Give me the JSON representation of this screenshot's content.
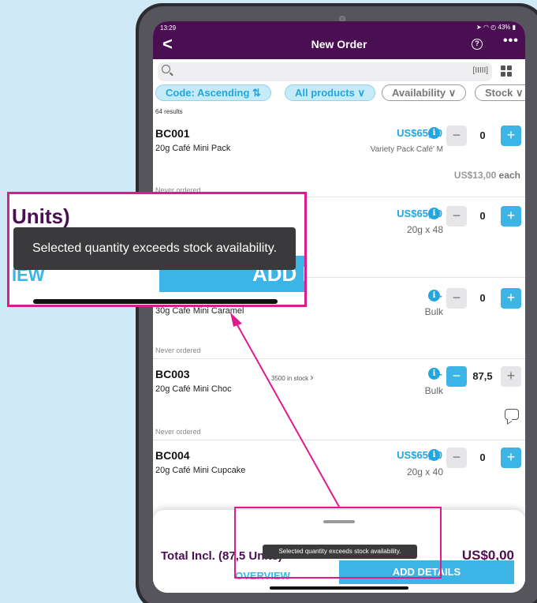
{
  "status_bar": {
    "time": "13:29",
    "indicators": "➤ ◠ ◴ 43% ▮"
  },
  "header": {
    "title": "New Order",
    "back_glyph": "<",
    "help_glyph": "?",
    "more_glyph": "•••"
  },
  "search": {
    "placeholder": "",
    "barcode_glyph": "[IIIII]"
  },
  "filters": [
    {
      "label": "Code: Ascending ⇅"
    },
    {
      "label": "All products ∨"
    },
    {
      "label": "Availability ∨"
    },
    {
      "label": "Stock ∨"
    }
  ],
  "results_count": "64 results",
  "products": [
    {
      "code": "BC001",
      "name": "20g Café Mini Pack",
      "price": "US$65,00",
      "subtitle": "Variety Pack Café' M",
      "each": "US$13,00",
      "each_suffix": "each",
      "qty": "0",
      "history": "Never ordered"
    },
    {
      "code": "",
      "name": "",
      "price": "US$65,00",
      "subtitle": "20g x 48",
      "qty": "0",
      "history": ""
    },
    {
      "code": "",
      "name": "30g Cafe Mini Caramel",
      "price": "$ -",
      "subtitle": "Bulk",
      "qty": "0",
      "history": "Never ordered"
    },
    {
      "code": "BC003",
      "name": "20g Café Mini Choc",
      "stock": "3500 in stock",
      "price": "$ -",
      "subtitle": "Bulk",
      "qty": "87,5",
      "history": "Never ordered"
    },
    {
      "code": "BC004",
      "name": "20g Café Mini Cupcake",
      "price": "US$65,00",
      "subtitle": "20g x 40",
      "qty": "0",
      "history": ""
    }
  ],
  "footer": {
    "total_label": "Total Incl. (87,5 Units)",
    "total_amount": "US$0,00",
    "overview_label": "OVERVIEW",
    "add_details_label": "ADD DETAILS",
    "toast": "Selected quantity exceeds stock availability."
  },
  "zoom": {
    "total_fragment": "Units)",
    "toast": "Selected quantity exceeds stock availability.",
    "overview_fragment": "IEW",
    "add_fragment": "ADD D"
  },
  "colors": {
    "brand_purple": "#4a0f53",
    "accent_blue": "#22a6de",
    "highlight_pink": "#e01a8d"
  }
}
